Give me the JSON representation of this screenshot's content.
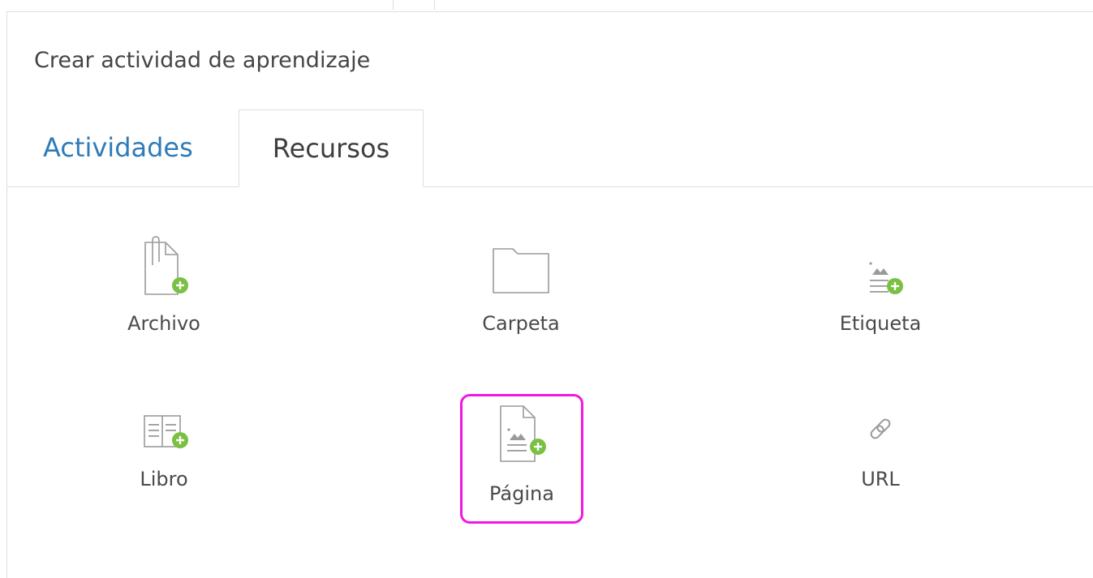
{
  "dialog": {
    "title": "Crear actividad de aprendizaje"
  },
  "tabs": [
    {
      "label": "Actividades",
      "active": false
    },
    {
      "label": "Recursos",
      "active": true
    }
  ],
  "resources": [
    {
      "label": "Archivo",
      "icon": "file-add-icon"
    },
    {
      "label": "Carpeta",
      "icon": "folder-icon"
    },
    {
      "label": "Etiqueta",
      "icon": "label-add-icon"
    },
    {
      "label": "Libro",
      "icon": "book-add-icon"
    },
    {
      "label": "Página",
      "icon": "page-add-icon",
      "selected": true
    },
    {
      "label": "URL",
      "icon": "link-icon"
    }
  ],
  "colors": {
    "accent_tab": "#2f7bb9",
    "add_badge": "#7bc043",
    "selection_outline": "#f018e4",
    "icon_stroke": "#9a9a9a"
  }
}
